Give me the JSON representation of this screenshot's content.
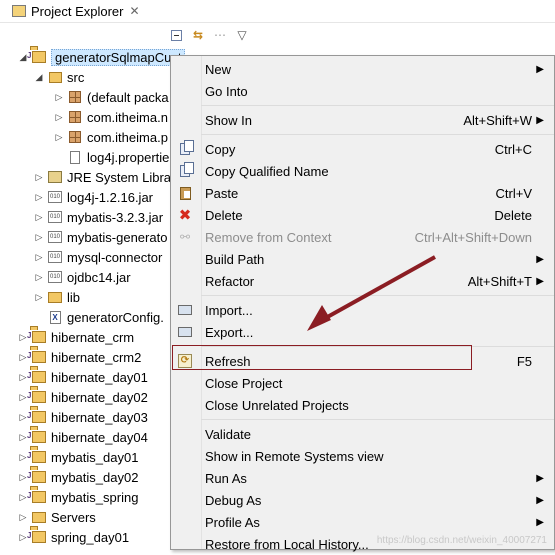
{
  "view": {
    "tab_title": "Project Explorer",
    "tab_close": "✕"
  },
  "toolbar": {
    "collapse_all": "collapse-all",
    "link_editor": "⇆",
    "filters": "⋯",
    "view_menu": "▽"
  },
  "tree": [
    {
      "label": "generatorSqlmapCust",
      "icon": "java-project-icon",
      "level": 0,
      "twisty": "◢",
      "selected": true
    },
    {
      "label": "src",
      "icon": "source-folder-icon",
      "level": 1,
      "twisty": "◢"
    },
    {
      "label": "(default packa",
      "icon": "package-icon",
      "level": 2,
      "twisty": "▷"
    },
    {
      "label": "com.itheima.n",
      "icon": "package-icon",
      "level": 2,
      "twisty": "▷"
    },
    {
      "label": "com.itheima.p",
      "icon": "package-icon",
      "level": 2,
      "twisty": "▷"
    },
    {
      "label": "log4j.propertie",
      "icon": "file-icon",
      "level": 2,
      "twisty": ""
    },
    {
      "label": "JRE System Libra",
      "icon": "library-icon",
      "level": 1,
      "twisty": "▷"
    },
    {
      "label": "log4j-1.2.16.jar",
      "icon": "jar-icon",
      "level": 1,
      "twisty": "▷"
    },
    {
      "label": "mybatis-3.2.3.jar",
      "icon": "jar-icon",
      "level": 1,
      "twisty": "▷"
    },
    {
      "label": "mybatis-generato",
      "icon": "jar-icon",
      "level": 1,
      "twisty": "▷"
    },
    {
      "label": "mysql-connector",
      "icon": "jar-icon",
      "level": 1,
      "twisty": "▷"
    },
    {
      "label": "ojdbc14.jar",
      "icon": "jar-icon",
      "level": 1,
      "twisty": "▷"
    },
    {
      "label": "lib",
      "icon": "folder-icon",
      "level": 1,
      "twisty": "▷"
    },
    {
      "label": "generatorConfig.",
      "icon": "xml-file-icon",
      "level": 1,
      "twisty": ""
    },
    {
      "label": "hibernate_crm",
      "icon": "java-project-icon",
      "level": 0,
      "twisty": "▷"
    },
    {
      "label": "hibernate_crm2",
      "icon": "java-project-icon",
      "level": 0,
      "twisty": "▷"
    },
    {
      "label": "hibernate_day01",
      "icon": "java-project-icon",
      "level": 0,
      "twisty": "▷"
    },
    {
      "label": "hibernate_day02",
      "icon": "java-project-icon",
      "level": 0,
      "twisty": "▷"
    },
    {
      "label": "hibernate_day03",
      "icon": "java-project-icon",
      "level": 0,
      "twisty": "▷"
    },
    {
      "label": "hibernate_day04",
      "icon": "java-project-icon",
      "level": 0,
      "twisty": "▷"
    },
    {
      "label": "mybatis_day01",
      "icon": "java-project-icon",
      "level": 0,
      "twisty": "▷"
    },
    {
      "label": "mybatis_day02",
      "icon": "java-project-icon",
      "level": 0,
      "twisty": "▷"
    },
    {
      "label": "mybatis_spring",
      "icon": "java-project-icon",
      "level": 0,
      "twisty": "▷"
    },
    {
      "label": "Servers",
      "icon": "folder-icon",
      "level": 0,
      "twisty": "▷"
    },
    {
      "label": "spring_day01",
      "icon": "java-project-icon",
      "level": 0,
      "twisty": "▷"
    }
  ],
  "menu": {
    "new": {
      "label": "New",
      "key": ""
    },
    "go_into": {
      "label": "Go Into",
      "key": ""
    },
    "show_in": {
      "label": "Show In",
      "key": "Alt+Shift+W"
    },
    "copy": {
      "label": "Copy",
      "key": "Ctrl+C"
    },
    "copy_qualified": {
      "label": "Copy Qualified Name",
      "key": ""
    },
    "paste": {
      "label": "Paste",
      "key": "Ctrl+V"
    },
    "delete": {
      "label": "Delete",
      "key": "Delete"
    },
    "remove_context": {
      "label": "Remove from Context",
      "key": "Ctrl+Alt+Shift+Down"
    },
    "build_path": {
      "label": "Build Path",
      "key": ""
    },
    "refactor": {
      "label": "Refactor",
      "key": "Alt+Shift+T"
    },
    "import": {
      "label": "Import...",
      "key": ""
    },
    "export": {
      "label": "Export...",
      "key": ""
    },
    "refresh": {
      "label": "Refresh",
      "key": "F5"
    },
    "close_project": {
      "label": "Close Project",
      "key": ""
    },
    "close_unrelated": {
      "label": "Close Unrelated Projects",
      "key": ""
    },
    "validate": {
      "label": "Validate",
      "key": ""
    },
    "show_remote": {
      "label": "Show in Remote Systems view",
      "key": ""
    },
    "run_as": {
      "label": "Run As",
      "key": ""
    },
    "debug_as": {
      "label": "Debug As",
      "key": ""
    },
    "profile_as": {
      "label": "Profile As",
      "key": ""
    },
    "restore_history": {
      "label": "Restore from Local History...",
      "key": ""
    },
    "submenu_arrow": "▶"
  },
  "watermark": "https://blog.csdn.net/weixin_40007271",
  "colors": {
    "annotation": "#8b1d23",
    "menu_bg": "#f0f0f0",
    "selection": "#cde8ff"
  }
}
